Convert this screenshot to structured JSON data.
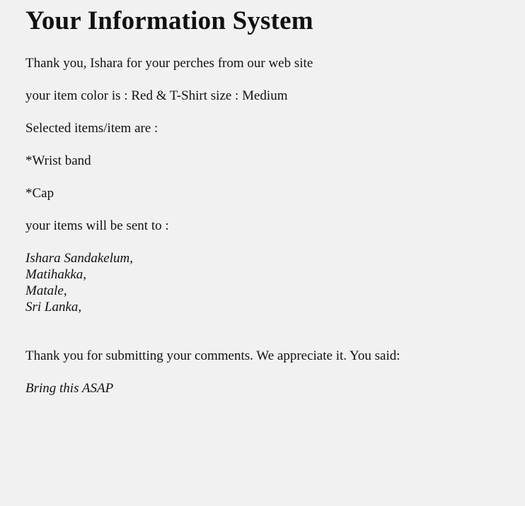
{
  "page": {
    "title": "Your Information System",
    "thanks": "Thank you, Ishara for your perches from our web site",
    "item_details": "your item color is : Red & T-Shirt size : Medium",
    "selected_label": "Selected items/item are :",
    "selected_items": [
      "*Wrist band",
      "*Cap"
    ],
    "shipping_label": "your items will be sent to :",
    "address_lines": [
      "Ishara Sandakelum,",
      "Matihakka,",
      "Matale,",
      "Sri Lanka,"
    ],
    "comments_intro": "Thank you for submitting your comments. We appreciate it. You said:",
    "comment_text": "Bring this ASAP"
  }
}
